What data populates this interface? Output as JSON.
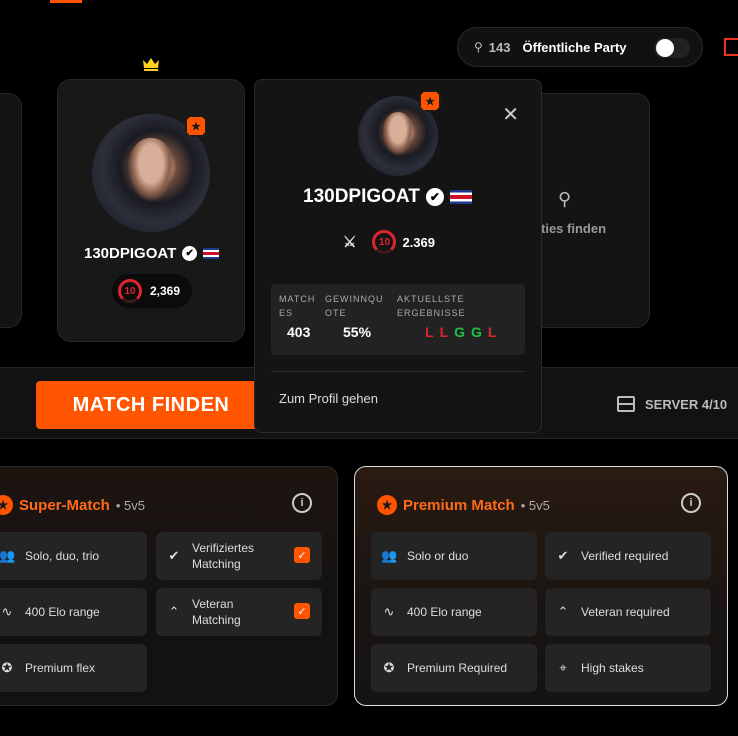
{
  "header": {
    "party_count": "143",
    "party_label": "Öffentliche Party"
  },
  "player": {
    "name": "130DPIGOAT",
    "level": "10",
    "elo": "2,369"
  },
  "find_card": {
    "text": "ties finden"
  },
  "popup": {
    "name": "130DPIGOAT",
    "level": "10",
    "elo": "2.369",
    "stats": {
      "matches_label": "MATCH ES",
      "matches": "403",
      "winrate_label": "GEWINNQU OTE",
      "winrate": "55%",
      "recent_label": "AKTUELLSTE ERGEBNISSE",
      "recent": [
        "L",
        "L",
        "G",
        "G",
        "L"
      ]
    },
    "profile_link": "Zum Profil gehen",
    "colors": {
      "loss": "#e0242f",
      "win": "#1fbf4a"
    }
  },
  "action_bar": {
    "match_button": "MATCH FINDEN",
    "server": "SERVER 4/10"
  },
  "super_match": {
    "title": "Super-Match",
    "mode": "• 5v5",
    "features": [
      "Solo, duo, trio",
      "Verifiziertes Matching",
      "400 Elo range",
      "Veteran Matching",
      "Premium flex"
    ]
  },
  "premium_match": {
    "title": "Premium Match",
    "mode": "• 5v5",
    "features": [
      "Solo or duo",
      "Verified required",
      "400 Elo range",
      "Veteran required",
      "Premium Required",
      "High stakes"
    ]
  },
  "accent": "#ff5500"
}
